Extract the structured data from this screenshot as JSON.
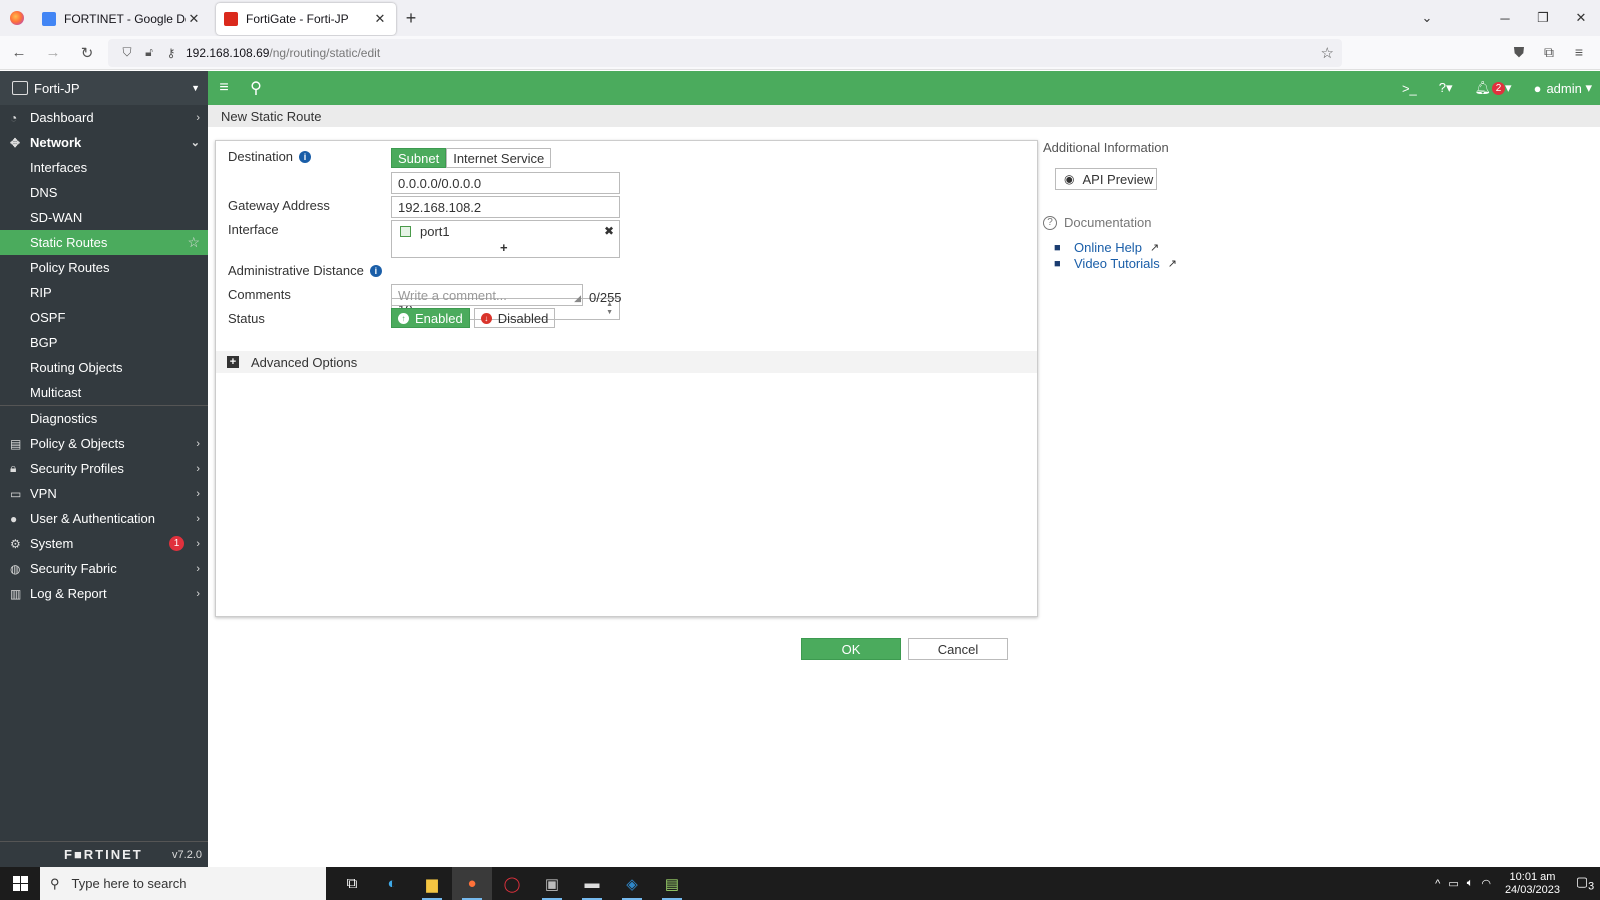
{
  "browser": {
    "tabs": [
      {
        "title": "FORTINET - Google Docs",
        "active": false
      },
      {
        "title": "FortiGate - Forti-JP",
        "active": true
      }
    ],
    "url_host": "192.168.108.69",
    "url_path": "/ng/routing/static/edit"
  },
  "sidebar": {
    "device": "Forti-JP",
    "items": [
      {
        "label": "Dashboard"
      },
      {
        "label": "Network"
      },
      {
        "label": "Interfaces"
      },
      {
        "label": "DNS"
      },
      {
        "label": "SD-WAN"
      },
      {
        "label": "Static Routes"
      },
      {
        "label": "Policy Routes"
      },
      {
        "label": "RIP"
      },
      {
        "label": "OSPF"
      },
      {
        "label": "BGP"
      },
      {
        "label": "Routing Objects"
      },
      {
        "label": "Multicast"
      },
      {
        "label": "Diagnostics"
      },
      {
        "label": "Policy & Objects"
      },
      {
        "label": "Security Profiles"
      },
      {
        "label": "VPN"
      },
      {
        "label": "User & Authentication"
      },
      {
        "label": "System",
        "badge": "1"
      },
      {
        "label": "Security Fabric"
      },
      {
        "label": "Log & Report"
      }
    ],
    "brand": "F■RTINET",
    "version": "v7.2.0"
  },
  "topbar": {
    "notifications": "2",
    "user": "admin"
  },
  "breadcrumb": "New Static Route",
  "form": {
    "destination_label": "Destination",
    "dest_subnet": "Subnet",
    "dest_internet_service": "Internet Service",
    "destination_value": "0.0.0.0/0.0.0.0",
    "gateway_label": "Gateway Address",
    "gateway_value": "192.168.108.2",
    "interface_label": "Interface",
    "interface_value": "port1",
    "distance_label": "Administrative Distance",
    "distance_value": "10",
    "comments_label": "Comments",
    "comments_placeholder": "Write a comment...",
    "comments_counter": "0/255",
    "status_label": "Status",
    "status_enabled": "Enabled",
    "status_disabled": "Disabled",
    "advanced_options": "Advanced Options",
    "ok": "OK",
    "cancel": "Cancel"
  },
  "info": {
    "title": "Additional Information",
    "api_preview": "API Preview",
    "documentation": "Documentation",
    "online_help": "Online Help",
    "video_tutorials": "Video Tutorials"
  },
  "taskbar": {
    "search_placeholder": "Type here to search",
    "time": "10:01 am",
    "date": "24/03/2023",
    "notification_count": "3"
  },
  "colors": {
    "accent_green": "#4bab5d",
    "sidebar_bg": "#333a3f",
    "badge_red": "#e0313d",
    "link_blue": "#1a5ea8"
  }
}
